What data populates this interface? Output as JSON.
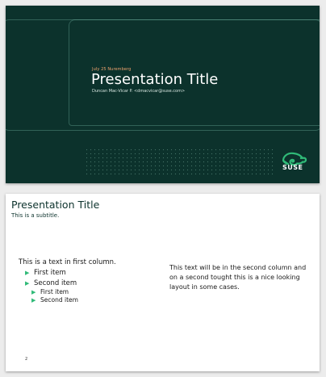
{
  "colors": {
    "dark_bg": "#0c322c",
    "accent_green": "#30ba78",
    "date_orange": "#f0a36e",
    "title_green": "#0c322c",
    "bullet_green": "#30ba78"
  },
  "slide1": {
    "date_location": "July 25 Nuremberg",
    "title": "Presentation Title",
    "author": "Duncan Mac-Vicar P. <dmacvicar@suse.com>",
    "logo_icon": "chameleon-icon",
    "logo_text": "SUSE"
  },
  "slide2": {
    "title": "Presentation Title",
    "subtitle": "This is a subtitle.",
    "column1": {
      "intro": "This is a text in first column.",
      "items": [
        {
          "label": "First item",
          "subitems": []
        },
        {
          "label": "Second item",
          "subitems": [
            "First item",
            "Second item"
          ]
        }
      ]
    },
    "column2_text": "This text will be in the second column and on a second tought this is a nice looking layout in some cases.",
    "page_number": "2"
  }
}
